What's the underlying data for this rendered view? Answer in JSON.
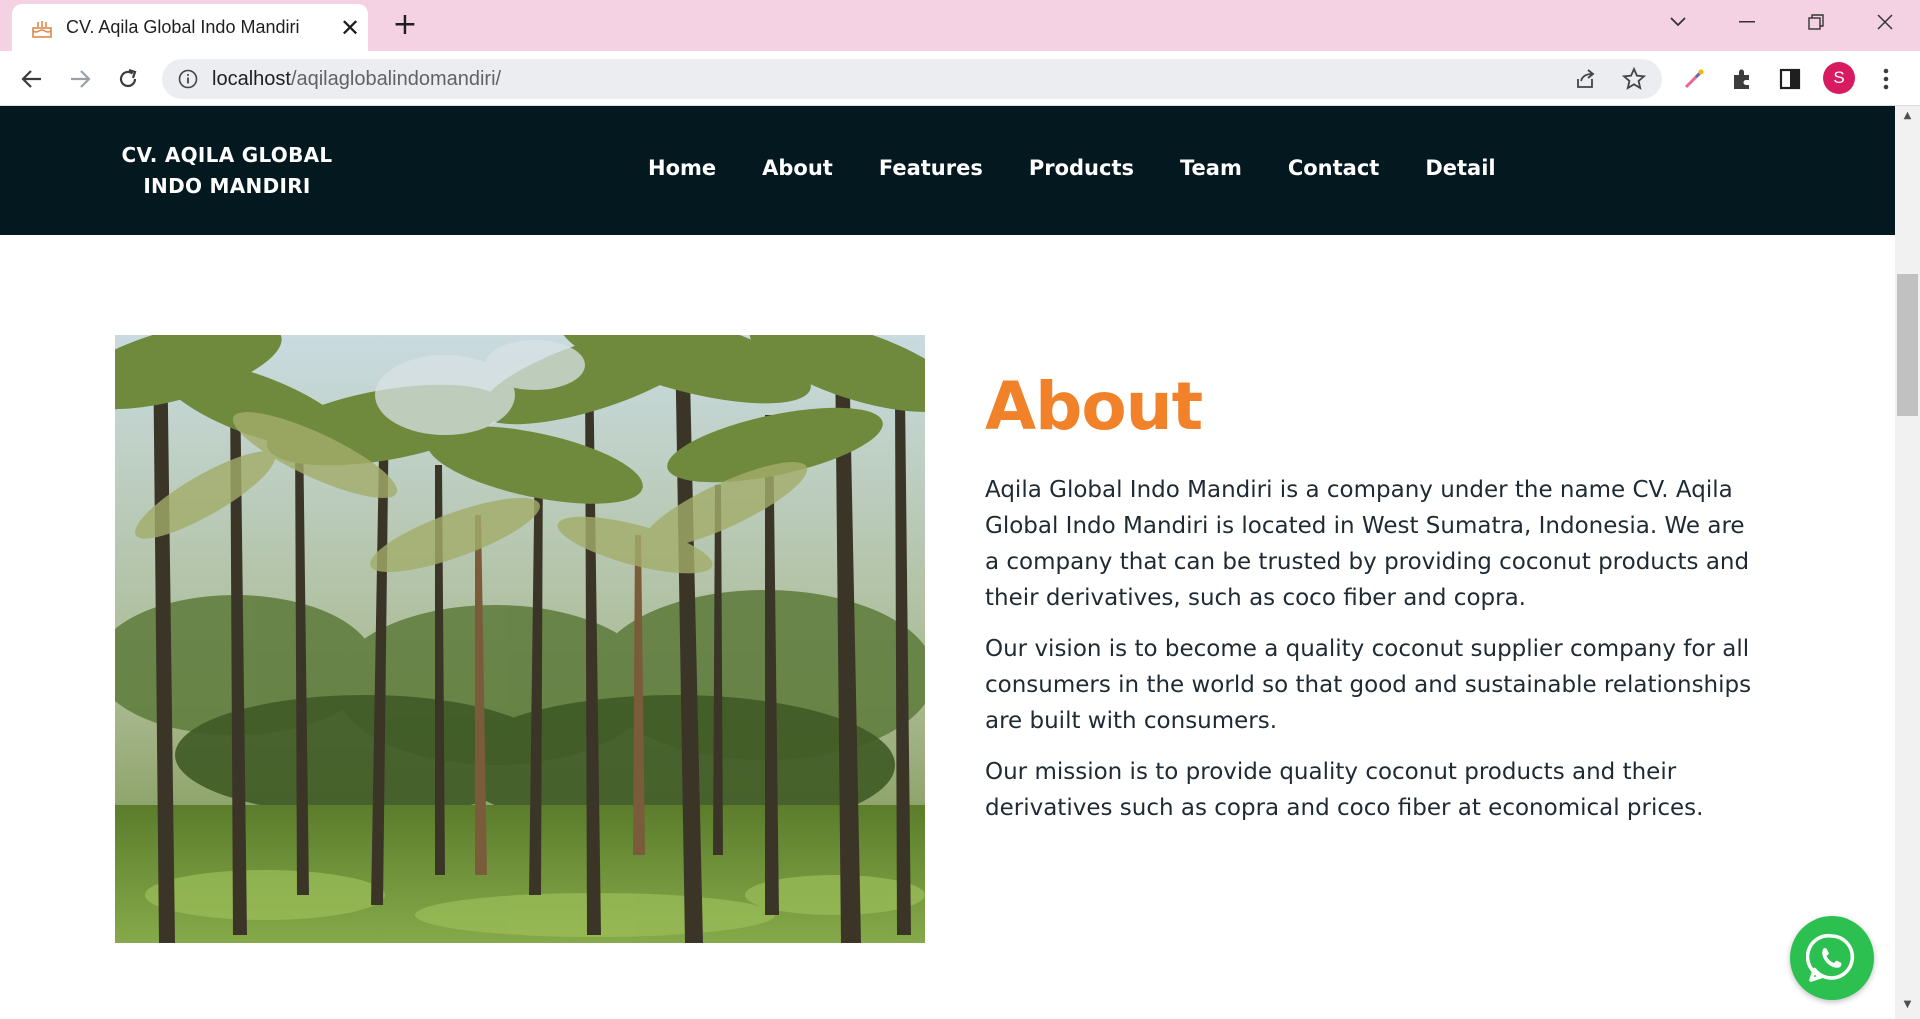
{
  "browser": {
    "tab_title": "CV. Aqila Global Indo Mandiri",
    "url_host": "localhost",
    "url_path": "/aqilaglobalindomandiri/",
    "profile_initial": "S"
  },
  "site": {
    "logo_line1": "CV. AQILA GLOBAL",
    "logo_line2": "INDO MANDIRI",
    "nav": [
      "Home",
      "About",
      "Features",
      "Products",
      "Team",
      "Contact",
      "Detail"
    ]
  },
  "about": {
    "title": "About",
    "paragraphs": [
      "Aqila Global Indo Mandiri is a company under the name CV. Aqila Global Indo Mandiri is located in West Sumatra, Indonesia. We are a company that can be trusted by providing coconut products and their derivatives, such as coco fiber and copra.",
      "Our vision is to become a quality coconut supplier company for all consumers in the world so that good and sustainable relationships are built with consumers.",
      "Our mission is to provide quality coconut products and their derivatives such as copra and coco fiber at economical prices."
    ]
  },
  "colors": {
    "header_bg": "#041820",
    "accent": "#f1822a",
    "tabstrip": "#f4d2e3",
    "whatsapp": "#2bc04f"
  },
  "icons": {
    "favicon": "cake-icon",
    "whatsapp": "whatsapp-icon"
  }
}
